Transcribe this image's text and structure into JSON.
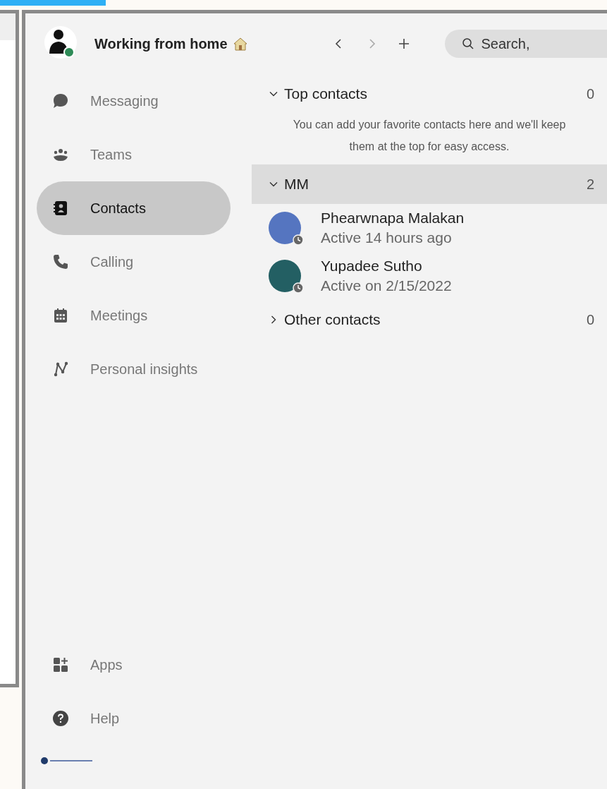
{
  "header": {
    "status_text": "Working from home",
    "search": {
      "placeholder": "Search,"
    }
  },
  "sidebar": {
    "items": [
      {
        "label": "Messaging",
        "kind": "chat",
        "selected": false
      },
      {
        "label": "Teams",
        "kind": "team",
        "selected": false
      },
      {
        "label": "Contacts",
        "kind": "contacts",
        "selected": true
      },
      {
        "label": "Calling",
        "kind": "phone",
        "selected": false
      },
      {
        "label": "Meetings",
        "kind": "calendar",
        "selected": false
      },
      {
        "label": "Personal insights",
        "kind": "insights",
        "selected": false
      }
    ],
    "bottom_items": [
      {
        "label": "Apps",
        "kind": "apps"
      },
      {
        "label": "Help",
        "kind": "help"
      }
    ]
  },
  "groups": [
    {
      "title": "Top contacts",
      "count": "0",
      "expanded": true,
      "selected": false,
      "empty_message": "You can add your favorite contacts here and we'll keep them at the top for easy access."
    },
    {
      "title": "MM",
      "count": "2",
      "expanded": true,
      "selected": true,
      "contacts": [
        {
          "name": "Phearwnapa Malakan",
          "status": "Active 14 hours ago"
        },
        {
          "name": "Yupadee Sutho",
          "status": "Active on 2/15/2022"
        }
      ]
    },
    {
      "title": "Other contacts",
      "count": "0",
      "expanded": false,
      "selected": false
    }
  ]
}
